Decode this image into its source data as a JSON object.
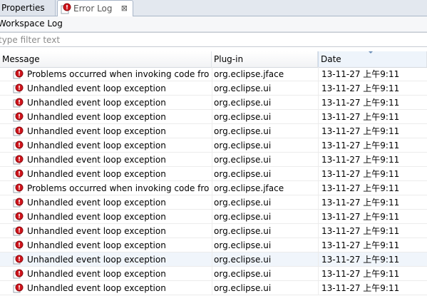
{
  "tabs": [
    {
      "label": "Properties",
      "active": false
    },
    {
      "label": "Error Log",
      "active": true,
      "close": "⊠"
    }
  ],
  "view_title": "Workspace Log",
  "filter": {
    "placeholder": "type filter text"
  },
  "columns": {
    "message": "Message",
    "plugin": "Plug-in",
    "date": "Date"
  },
  "rows": [
    {
      "message": "Problems occurred when invoking code from plug-in: \"org.eclipse.jface\".",
      "plugin": "org.eclipse.jface",
      "date": "13-11-27 上午9:11"
    },
    {
      "message": "Unhandled event loop exception",
      "plugin": "org.eclipse.ui",
      "date": "13-11-27 上午9:11"
    },
    {
      "message": "Unhandled event loop exception",
      "plugin": "org.eclipse.ui",
      "date": "13-11-27 上午9:11"
    },
    {
      "message": "Unhandled event loop exception",
      "plugin": "org.eclipse.ui",
      "date": "13-11-27 上午9:11"
    },
    {
      "message": "Unhandled event loop exception",
      "plugin": "org.eclipse.ui",
      "date": "13-11-27 上午9:11"
    },
    {
      "message": "Unhandled event loop exception",
      "plugin": "org.eclipse.ui",
      "date": "13-11-27 上午9:11"
    },
    {
      "message": "Unhandled event loop exception",
      "plugin": "org.eclipse.ui",
      "date": "13-11-27 上午9:11"
    },
    {
      "message": "Unhandled event loop exception",
      "plugin": "org.eclipse.ui",
      "date": "13-11-27 上午9:11"
    },
    {
      "message": "Problems occurred when invoking code from plug-in: \"org.eclipse.jface\".",
      "plugin": "org.eclipse.jface",
      "date": "13-11-27 上午9:11"
    },
    {
      "message": "Unhandled event loop exception",
      "plugin": "org.eclipse.ui",
      "date": "13-11-27 上午9:11"
    },
    {
      "message": "Unhandled event loop exception",
      "plugin": "org.eclipse.ui",
      "date": "13-11-27 上午9:11"
    },
    {
      "message": "Unhandled event loop exception",
      "plugin": "org.eclipse.ui",
      "date": "13-11-27 上午9:11"
    },
    {
      "message": "Unhandled event loop exception",
      "plugin": "org.eclipse.ui",
      "date": "13-11-27 上午9:11"
    },
    {
      "message": "Unhandled event loop exception",
      "plugin": "org.eclipse.ui",
      "date": "13-11-27 上午9:11",
      "selected": true
    },
    {
      "message": "Unhandled event loop exception",
      "plugin": "org.eclipse.ui",
      "date": "13-11-27 上午9:11"
    },
    {
      "message": "Unhandled event loop exception",
      "plugin": "org.eclipse.ui",
      "date": "13-11-27 上午9:11"
    }
  ],
  "icons": {
    "tab_icon": "error-log-icon",
    "row_icon": "error-icon"
  },
  "colors": {
    "error_red": "#d0141c",
    "tab_bar": "#e3e8ef",
    "selected_row": "#f0f5fb"
  }
}
